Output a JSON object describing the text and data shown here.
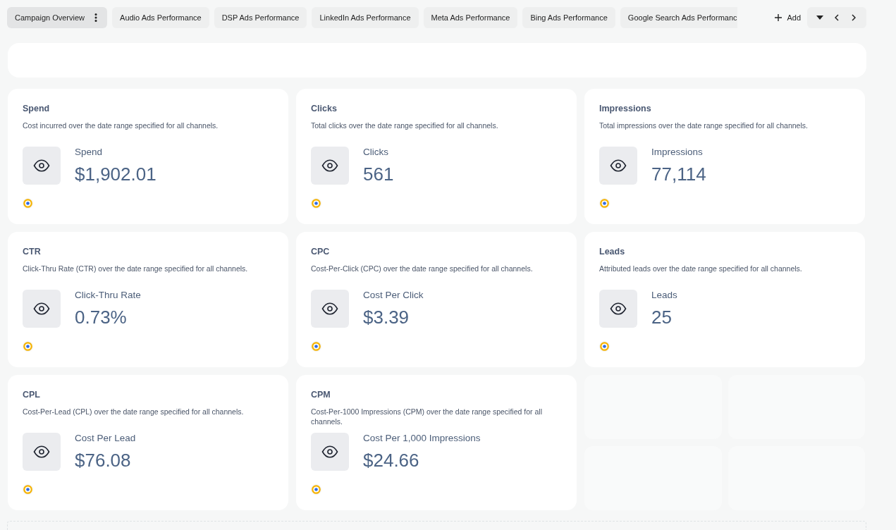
{
  "tabs": [
    {
      "label": "Campaign Overview",
      "selected": true
    },
    {
      "label": "Audio Ads Performance",
      "selected": false
    },
    {
      "label": "DSP Ads Performance",
      "selected": false
    },
    {
      "label": "LinkedIn Ads Performance",
      "selected": false
    },
    {
      "label": "Meta Ads Performance",
      "selected": false
    },
    {
      "label": "Bing Ads Performance",
      "selected": false
    },
    {
      "label": "Google Search Ads Performanc",
      "selected": false
    }
  ],
  "add_button": {
    "label": "Add"
  },
  "cards": [
    {
      "title": "Spend",
      "description": "Cost incurred over the date range specified for all channels.",
      "metric_label": "Spend",
      "value": "$1,902.01"
    },
    {
      "title": "Clicks",
      "description": "Total clicks over the date range specified for all channels.",
      "metric_label": "Clicks",
      "value": "561"
    },
    {
      "title": "Impressions",
      "description": "Total impressions over the date range specified for all channels.",
      "metric_label": "Impressions",
      "value": "77,114"
    },
    {
      "title": "CTR",
      "description": "Click-Thru Rate (CTR) over the date range specified for all channels.",
      "metric_label": "Click-Thru Rate",
      "value": "0.73%"
    },
    {
      "title": "CPC",
      "description": "Cost-Per-Click (CPC) over the date range specified for all channels.",
      "metric_label": "Cost Per Click",
      "value": "$3.39"
    },
    {
      "title": "Leads",
      "description": "Attributed leads over the date range specified for all channels.",
      "metric_label": "Leads",
      "value": "25"
    },
    {
      "title": "CPL",
      "description": "Cost-Per-Lead (CPL) over the date range specified for all channels.",
      "metric_label": "Cost Per Lead",
      "value": "$76.08"
    },
    {
      "title": "CPM",
      "description": "Cost-Per-1000 Impressions (CPM) over the date range specified for all channels.",
      "metric_label": "Cost Per 1,000 Impressions",
      "value": "$24.66"
    }
  ]
}
